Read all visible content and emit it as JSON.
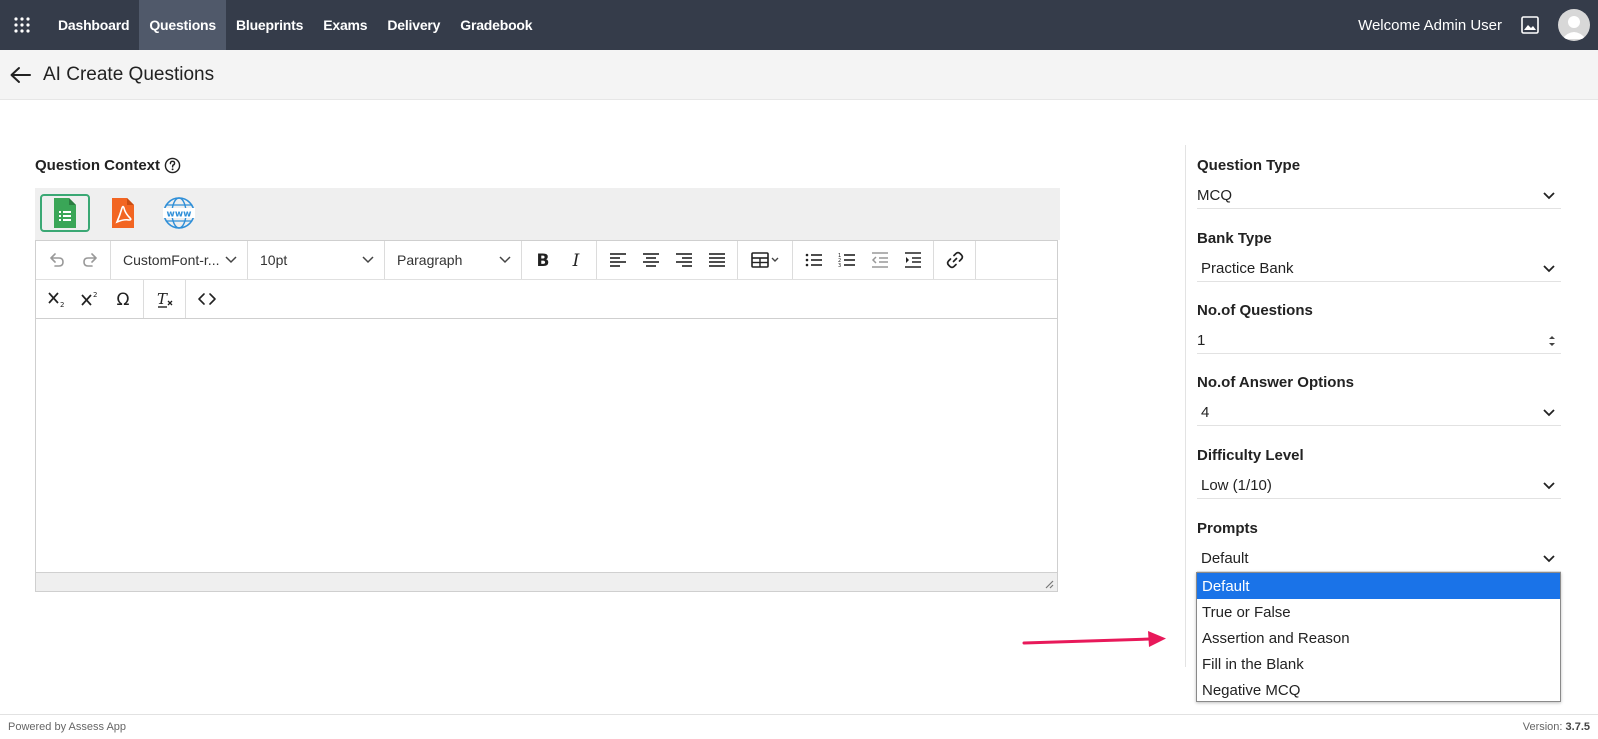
{
  "nav": {
    "items": [
      "Dashboard",
      "Questions",
      "Blueprints",
      "Exams",
      "Delivery",
      "Gradebook"
    ],
    "active": "Questions",
    "welcome": "Welcome Admin User"
  },
  "page": {
    "title": "AI Create Questions"
  },
  "context": {
    "label": "Question Context",
    "sources": [
      "spreadsheet-icon",
      "pdf-icon",
      "www-icon"
    ]
  },
  "editor": {
    "font": "CustomFont-r...",
    "size": "10pt",
    "block": "Paragraph"
  },
  "settings": {
    "question_type": {
      "label": "Question Type",
      "value": "MCQ"
    },
    "bank_type": {
      "label": "Bank Type",
      "value": "Practice Bank"
    },
    "num_questions": {
      "label": "No.of Questions",
      "value": "1"
    },
    "num_options": {
      "label": "No.of Answer Options",
      "value": "4"
    },
    "difficulty": {
      "label": "Difficulty Level",
      "value": "Low (1/10)"
    },
    "prompts": {
      "label": "Prompts",
      "value": "Default",
      "options": [
        "Default",
        "True or False",
        "Assertion and Reason",
        "Fill in the Blank",
        "Negative MCQ"
      ],
      "highlighted": "Default"
    }
  },
  "footer": {
    "powered": "Powered by Assess App",
    "version_label": "Version:",
    "version": "3.7.5"
  },
  "colors": {
    "nav_bg": "#353c4a",
    "highlight": "#1a73e8",
    "arrow": "#e8195a"
  }
}
